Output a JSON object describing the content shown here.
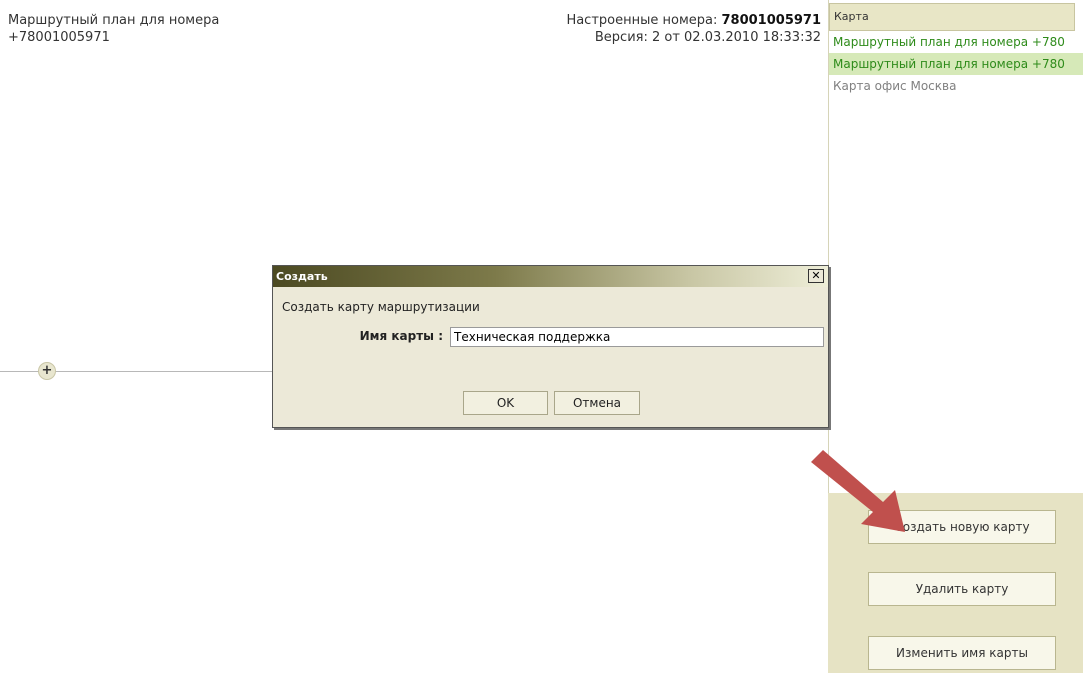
{
  "header": {
    "plan_title_line1": "Маршрутный план для номера",
    "plan_title_line2": "+78001005971",
    "configured_label": "Настроенные номера:",
    "configured_number": "78001005971",
    "version_text": "Версия: 2 от 02.03.2010 18:33:32"
  },
  "canvas": {
    "add_node_glyph": "+"
  },
  "map_panel": {
    "header_label": "Карта",
    "items": [
      {
        "label": "Маршрутный план для номера +780"
      },
      {
        "label": "Маршрутный план для номера +780"
      },
      {
        "label": "Карта офис Москва"
      }
    ],
    "buttons": {
      "create": "Создать новую карту",
      "delete": "Удалить карту",
      "rename": "Изменить имя карты"
    }
  },
  "dialog": {
    "title": "Создать",
    "close_glyph": "✕",
    "description": "Создать карту маршрутизации",
    "name_label": "Имя карты :",
    "name_value": "Техническая поддержка",
    "ok_label": "OK",
    "cancel_label": "Отмена"
  },
  "colors": {
    "panel_bg": "#e6e3c4",
    "item_green": "#2e8b1a",
    "item_selected_bg": "#d6e9b8",
    "arrow": "#c0504d"
  },
  "icons": {
    "arrow": "red-pointer-arrow-icon",
    "close": "close-icon",
    "add": "plus-icon"
  }
}
